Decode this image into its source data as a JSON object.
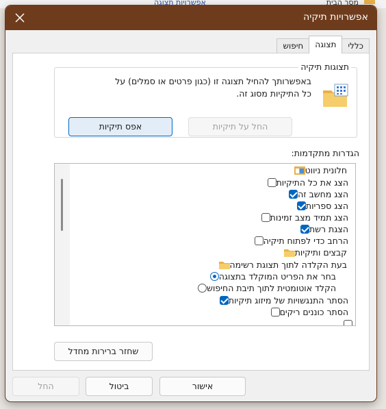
{
  "background": {
    "left_text": "אפשרויות תצוגה",
    "right_text": "מסך הבית"
  },
  "window": {
    "title": "אפשרויות תיקיה"
  },
  "tabs": [
    {
      "label": "כללי",
      "active": false
    },
    {
      "label": "תצוגה",
      "active": true
    },
    {
      "label": "חיפוש",
      "active": false
    }
  ],
  "folder_views": {
    "label": "תצוגות תיקיה",
    "description": "באפשרותך להחיל תצוגה זו (כגון פרטים או סמלים) על כל התיקיות מסוג זה.",
    "apply_button": "החל על תיקיות",
    "reset_button": "אפס תיקיות"
  },
  "advanced": {
    "label": "הגדרות מתקדמות:",
    "items": [
      {
        "type": "folder",
        "label": "חלונית ניווט"
      },
      {
        "type": "checkbox",
        "checked": false,
        "label": "הצג את כל התיקיות"
      },
      {
        "type": "checkbox",
        "checked": true,
        "label": "הצג מחשב זה"
      },
      {
        "type": "checkbox",
        "checked": true,
        "label": "הצג ספריות"
      },
      {
        "type": "checkbox",
        "checked": false,
        "label": "הצג תמיד מצב זמינות"
      },
      {
        "type": "checkbox",
        "checked": true,
        "label": "הצגת רשת"
      },
      {
        "type": "checkbox",
        "checked": false,
        "label": "הרחב כדי לפתוח תיקיה"
      },
      {
        "type": "folder",
        "label": "קבצים ותיקיות"
      },
      {
        "type": "folder",
        "label": "בעת הקלדה לתוך תצוגת רשימה"
      },
      {
        "type": "radio",
        "checked": true,
        "label": "בחר את הפריט המוקלד בתצוגה"
      },
      {
        "type": "radio",
        "checked": false,
        "label": "הקלד אוטומטית לתוך תיבת החיפוש"
      },
      {
        "type": "checkbox",
        "checked": true,
        "label": "הסתר התנגשויות של מיזוג תיקיות"
      },
      {
        "type": "checkbox",
        "checked": false,
        "label": "הסתר כוננים ריקים"
      }
    ]
  },
  "restore_button": "שחזר ברירות מחדל",
  "footer": {
    "ok": "אישור",
    "cancel": "ביטול",
    "apply": "החל"
  },
  "colors": {
    "titlebar": "#6e3c1c",
    "accent": "#0067c0",
    "folder": "#e8b04a"
  }
}
